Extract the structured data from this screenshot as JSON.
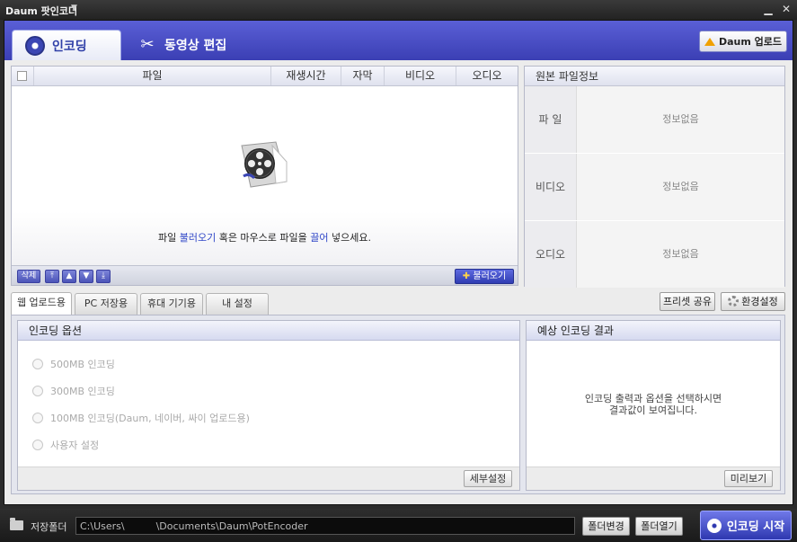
{
  "window": {
    "title": "Daum 팟인코더",
    "minimize": "▁",
    "close": "✕"
  },
  "tabs": {
    "encoding": "인코딩",
    "video_edit": "동영상 편집"
  },
  "upload_button": "Daum 업로드",
  "file_list": {
    "columns": [
      "파일",
      "재생시간",
      "자막",
      "비디오",
      "오디오"
    ],
    "hint_prefix": "파일 ",
    "hint_link1": "불러오기",
    "hint_mid": " 혹은 마우스로 파일을 ",
    "hint_link2": "끌어",
    "hint_suffix": " 넣으세요.",
    "delete_btn": "삭제",
    "load_btn": "불러오기"
  },
  "source_info": {
    "title": "원본 파일정보",
    "rows": [
      {
        "label": "파  일",
        "value": "정보없음"
      },
      {
        "label": "비디오",
        "value": "정보없음"
      },
      {
        "label": "오디오",
        "value": "정보없음"
      }
    ]
  },
  "preset_tabs": [
    "웹 업로드용",
    "PC 저장용",
    "휴대 기기용",
    "내 설정"
  ],
  "preset_share": "프리셋 공유",
  "settings_btn": "환경설정",
  "encoding_options": {
    "title": "인코딩 옵션",
    "items": [
      "500MB 인코딩",
      "300MB 인코딩",
      "100MB 인코딩(Daum, 네이버, 싸이 업로드용)",
      "사용자 설정"
    ],
    "detail_btn": "세부설정"
  },
  "expected_result": {
    "title": "예상 인코딩 결과",
    "message_line1": "인코딩 출력과 옵션을 선택하시면",
    "message_line2": "결과값이 보여집니다.",
    "preview_btn": "미리보기"
  },
  "bottom": {
    "save_folder_label": "저장폴더",
    "path": "C:\\Users\\          \\Documents\\Daum\\PotEncoder",
    "change_btn": "폴더변경",
    "open_btn": "폴더열기",
    "start_btn": "인코딩 시작"
  }
}
